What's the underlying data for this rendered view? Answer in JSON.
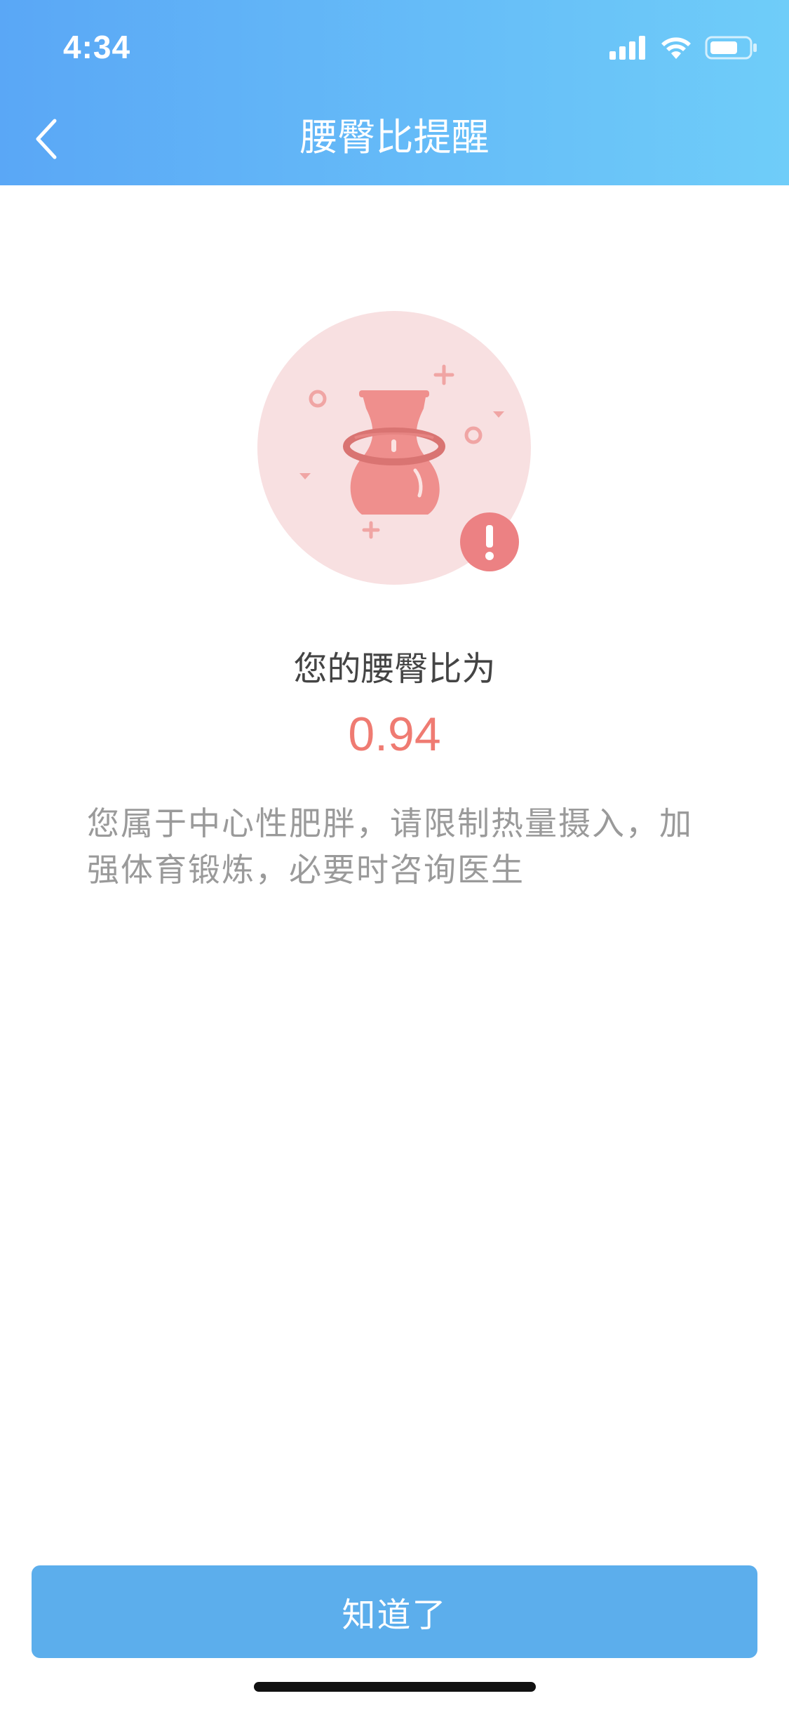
{
  "status_bar": {
    "time": "4:34",
    "signal_icon": "cellular-signal-icon",
    "wifi_icon": "wifi-icon",
    "battery_icon": "battery-icon"
  },
  "nav": {
    "back_icon": "chevron-left-icon",
    "title": "腰臀比提醒"
  },
  "illustration": {
    "icon": "vase-hoop-icon",
    "alert_icon": "exclamation-icon",
    "alert_text": "!",
    "colors": {
      "circle_bg": "#f8e0e1",
      "vase": "#ef8f8d",
      "vase_dark": "#d97472",
      "alert": "#ec8183",
      "decor": "#f0a5a4"
    }
  },
  "result": {
    "label": "您的腰臀比为",
    "value": "0.94",
    "value_color": "#ef7b72"
  },
  "advice": {
    "text": "您属于中心性肥胖，请限制热量摄入，加强体育锻炼，必要时咨询医生"
  },
  "button": {
    "label": "知道了",
    "color": "#5caeec"
  },
  "theme": {
    "header_gradient_start": "#5aa7f6",
    "header_gradient_end": "#6fcdf9"
  }
}
